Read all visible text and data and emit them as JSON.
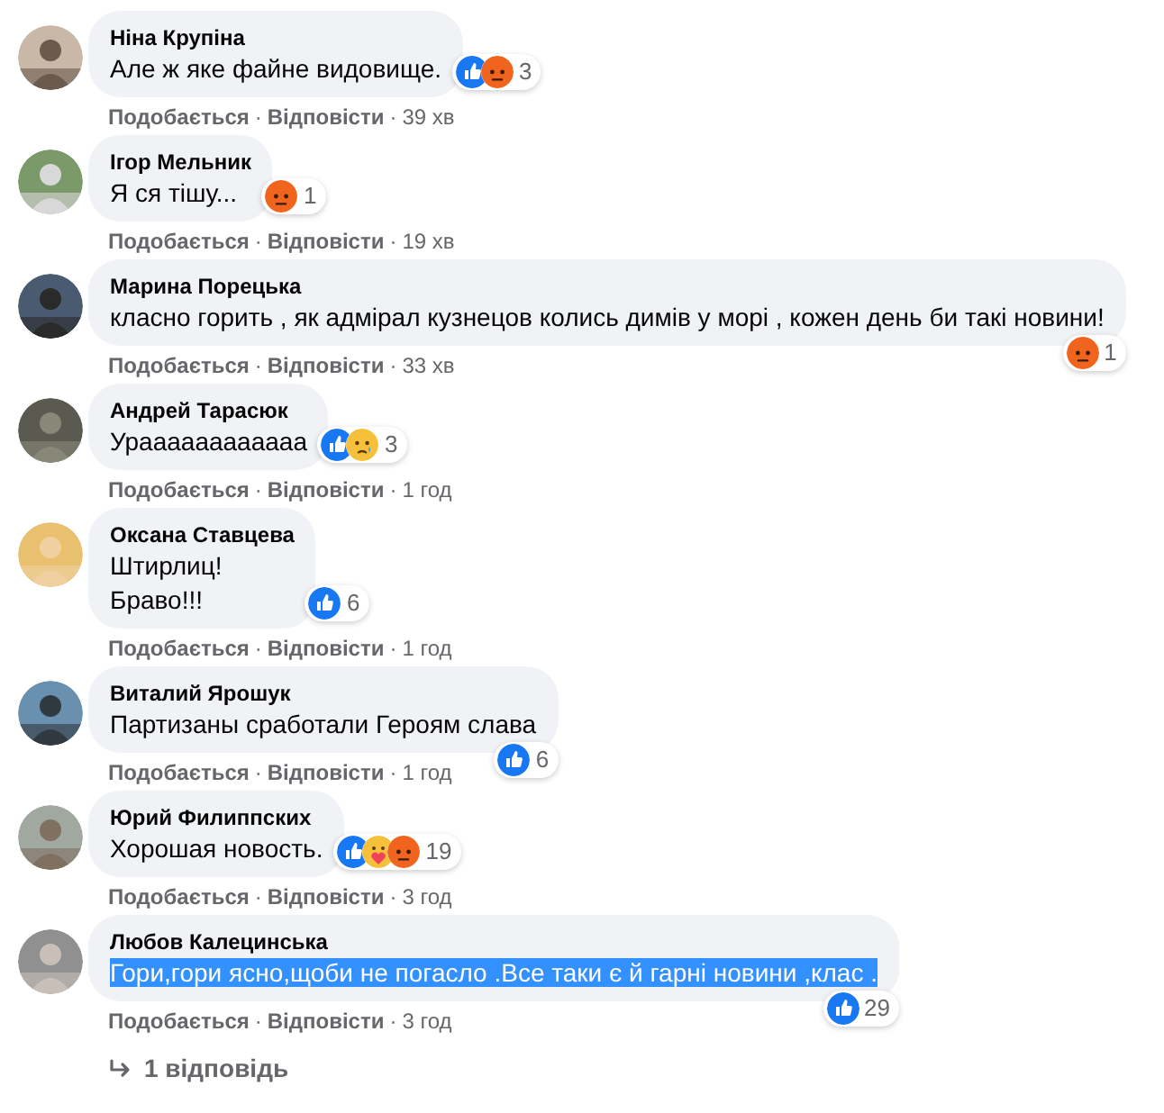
{
  "comments": [
    {
      "author": "Ніна Крупіна",
      "lines": [
        "Але ж яке файне видовище."
      ],
      "selected": false,
      "reactions": [
        {
          "kind": "like"
        },
        {
          "kind": "angry"
        }
      ],
      "reaction_count": "3",
      "meta": [
        {
          "kind": "action",
          "text": "Подобається"
        },
        {
          "kind": "separator",
          "text": "·"
        },
        {
          "kind": "action",
          "text": "Відповісти"
        },
        {
          "kind": "separator",
          "text": "·"
        },
        {
          "kind": "time",
          "text": "39 хв"
        }
      ]
    },
    {
      "author": "Ігор Мельник",
      "lines": [
        "Я ся тішу..."
      ],
      "selected": false,
      "reactions": [
        {
          "kind": "angry"
        }
      ],
      "reaction_count": "1",
      "meta": [
        {
          "kind": "action",
          "text": "Подобається"
        },
        {
          "kind": "separator",
          "text": "·"
        },
        {
          "kind": "action",
          "text": "Відповісти"
        },
        {
          "kind": "separator",
          "text": "·"
        },
        {
          "kind": "time",
          "text": "19 хв"
        }
      ]
    },
    {
      "author": "Марина Порецька",
      "lines": [
        "класно горить , як адмірал кузнецов колись димів у морі , кожен день би такі новини!"
      ],
      "selected": false,
      "reactions": [
        {
          "kind": "angry"
        }
      ],
      "reaction_count": "1",
      "meta": [
        {
          "kind": "action",
          "text": "Подобається"
        },
        {
          "kind": "separator",
          "text": "·"
        },
        {
          "kind": "action",
          "text": "Відповісти"
        },
        {
          "kind": "separator",
          "text": "·"
        },
        {
          "kind": "time",
          "text": "33 хв"
        }
      ]
    },
    {
      "author": "Андрей Тарасюк",
      "lines": [
        "Ураааааааааааа"
      ],
      "selected": false,
      "reactions": [
        {
          "kind": "like"
        },
        {
          "kind": "sad"
        }
      ],
      "reaction_count": "3",
      "meta": [
        {
          "kind": "action",
          "text": "Подобається"
        },
        {
          "kind": "separator",
          "text": "·"
        },
        {
          "kind": "action",
          "text": "Відповісти"
        },
        {
          "kind": "separator",
          "text": "·"
        },
        {
          "kind": "time",
          "text": "1 год"
        }
      ]
    },
    {
      "author": "Оксана Ставцева",
      "lines": [
        "Штирлиц!",
        "Браво!!!"
      ],
      "selected": false,
      "reactions": [
        {
          "kind": "like"
        }
      ],
      "reaction_count": "6",
      "meta": [
        {
          "kind": "action",
          "text": "Подобається"
        },
        {
          "kind": "separator",
          "text": "·"
        },
        {
          "kind": "action",
          "text": "Відповісти"
        },
        {
          "kind": "separator",
          "text": "·"
        },
        {
          "kind": "time",
          "text": "1 год"
        }
      ]
    },
    {
      "author": "Виталий Ярошук",
      "lines": [
        "Партизаны сработали Героям слава"
      ],
      "selected": false,
      "reactions": [
        {
          "kind": "like"
        }
      ],
      "reaction_count": "6",
      "meta": [
        {
          "kind": "action",
          "text": "Подобається"
        },
        {
          "kind": "separator",
          "text": "·"
        },
        {
          "kind": "action",
          "text": "Відповісти"
        },
        {
          "kind": "separator",
          "text": "·"
        },
        {
          "kind": "time",
          "text": "1 год"
        }
      ]
    },
    {
      "author": "Юрий Филиппских",
      "lines": [
        "Хорошая новость."
      ],
      "selected": false,
      "reactions": [
        {
          "kind": "like"
        },
        {
          "kind": "care"
        },
        {
          "kind": "angry"
        }
      ],
      "reaction_count": "19",
      "meta": [
        {
          "kind": "action",
          "text": "Подобається"
        },
        {
          "kind": "separator",
          "text": "·"
        },
        {
          "kind": "action",
          "text": "Відповісти"
        },
        {
          "kind": "separator",
          "text": "·"
        },
        {
          "kind": "time",
          "text": "3 год"
        }
      ]
    },
    {
      "author": "Любов Калецинська",
      "lines": [
        "Гори,гори ясно,щоби не погасло .Все таки є й гарні новини ,клас ."
      ],
      "selected": true,
      "reactions": [
        {
          "kind": "like"
        }
      ],
      "reaction_count": "29",
      "meta": [
        {
          "kind": "action",
          "text": "Подобається"
        },
        {
          "kind": "separator",
          "text": "·"
        },
        {
          "kind": "action",
          "text": "Відповісти"
        },
        {
          "kind": "separator",
          "text": "·"
        },
        {
          "kind": "time",
          "text": "3 год"
        }
      ]
    }
  ],
  "replies_link": {
    "label": "1 відповідь"
  }
}
